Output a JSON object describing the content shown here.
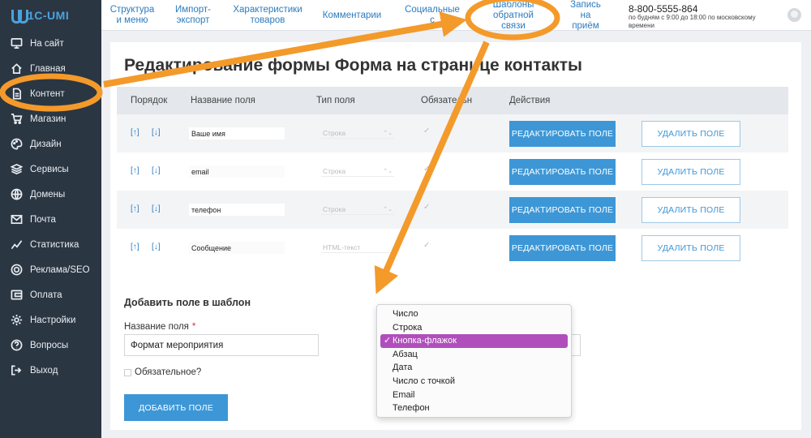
{
  "app": {
    "logo": "1C-UMI"
  },
  "sidebar": {
    "items": [
      {
        "label": "На сайт",
        "icon": "monitor-icon"
      },
      {
        "label": "Главная",
        "icon": "home-icon"
      },
      {
        "label": "Контент",
        "icon": "document-icon"
      },
      {
        "label": "Магазин",
        "icon": "cart-icon"
      },
      {
        "label": "Дизайн",
        "icon": "palette-icon"
      },
      {
        "label": "Сервисы",
        "icon": "stack-icon"
      },
      {
        "label": "Домены",
        "icon": "globe-icon"
      },
      {
        "label": "Почта",
        "icon": "mail-icon"
      },
      {
        "label": "Статистика",
        "icon": "chart-icon"
      },
      {
        "label": "Реклама/SEO",
        "icon": "target-icon"
      },
      {
        "label": "Оплата",
        "icon": "wallet-icon"
      },
      {
        "label": "Настройки",
        "icon": "gear-icon"
      },
      {
        "label": "Вопросы",
        "icon": "question-icon"
      },
      {
        "label": "Выход",
        "icon": "logout-icon"
      }
    ]
  },
  "tabs": [
    {
      "line1": "Структура",
      "line2": "и меню",
      "line3": ""
    },
    {
      "line1": "Импорт-",
      "line2": "экспорт",
      "line3": ""
    },
    {
      "line1": "Характеристики",
      "line2": "товаров",
      "line3": ""
    },
    {
      "line1": "Комментарии",
      "line2": "",
      "line3": ""
    },
    {
      "line1": "Социальные",
      "line2": "с",
      "line3": ""
    },
    {
      "line1": "Шаблоны",
      "line2": "обратной",
      "line3": "связи"
    },
    {
      "line1": "Запись",
      "line2": "на",
      "line3": "приём"
    }
  ],
  "contact": {
    "phone": "8-800-5555-864",
    "hours": "по будням с 9:00 до 18:00 по московскому времени"
  },
  "page": {
    "title": "Редактирование формы Форма на странице контакты"
  },
  "table": {
    "headers": {
      "order": "Порядок",
      "name": "Название поля",
      "type": "Тип поля",
      "required": "Обязательн",
      "actions": "Действия"
    },
    "up_arrow": "[↑]",
    "down_arrow": "[↓]",
    "check_mark": "✓",
    "select_arrow": "⌃⌄",
    "edit_label": "РЕДАКТИРОВАТЬ ПОЛЕ",
    "delete_label": "УДАЛИТЬ ПОЛЕ",
    "rows": [
      {
        "name": "Ваше имя",
        "type": "Строка"
      },
      {
        "name": "email",
        "type": "Строка"
      },
      {
        "name": "телефон",
        "type": "Строка"
      },
      {
        "name": "Сообщение",
        "type": "HTML-текст"
      }
    ]
  },
  "add_field": {
    "heading": "Добавить поле в шаблон",
    "name_label": "Название поля",
    "required_star": "*",
    "name_value": "Формат мероприятия",
    "required_label": "Обязательное?",
    "add_button": "ДОБАВИТЬ ПОЛЕ"
  },
  "type_dropdown": {
    "selected": "Кнопка-флажок",
    "check": "✓",
    "options": [
      "Число",
      "Строка",
      "Кнопка-флажок",
      "Абзац",
      "Дата",
      "Число с точкой",
      "Email",
      "Телефон"
    ]
  },
  "colors": {
    "sidebar_bg": "#2b3643",
    "accent_blue": "#3d97d6",
    "link_blue": "#2b7bbf",
    "annotation_orange": "#f39a2b",
    "dropdown_selected": "#b04fbc",
    "required_star": "#d9303b"
  }
}
